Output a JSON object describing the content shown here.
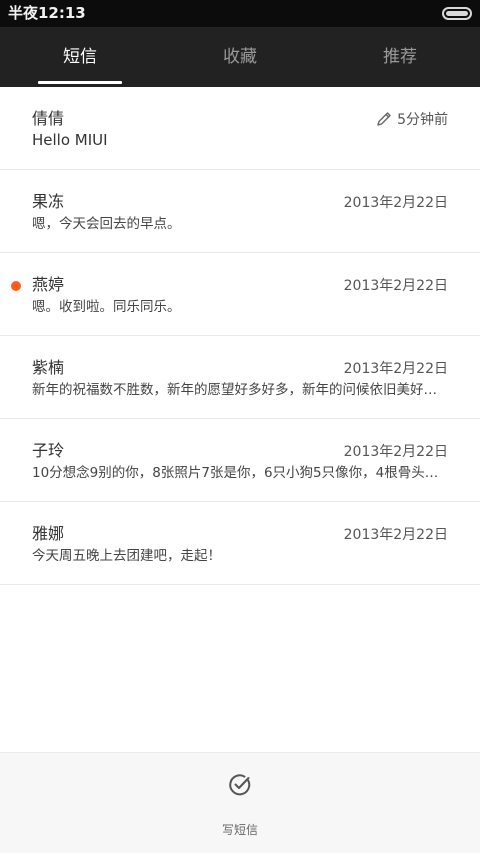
{
  "status_bar": {
    "time": "半夜12:13",
    "battery_icon": "battery-icon"
  },
  "tabs": [
    {
      "label": "短信",
      "active": true
    },
    {
      "label": "收藏",
      "active": false
    },
    {
      "label": "推荐",
      "active": false
    }
  ],
  "conversations": [
    {
      "name": "倩倩",
      "preview": "Hello MIUI",
      "time": "5分钟前",
      "draft": true,
      "unread": false
    },
    {
      "name": "果冻",
      "preview": "嗯，今天会回去的早点。",
      "time": "2013年2月22日",
      "draft": false,
      "unread": false
    },
    {
      "name": "燕婷",
      "preview": "嗯。收到啦。同乐同乐。",
      "time": "2013年2月22日",
      "draft": false,
      "unread": true
    },
    {
      "name": "紫楠",
      "preview": "新年的祝福数不胜数，新年的愿望好多好多，新年的问候依旧美好…",
      "time": "2013年2月22日",
      "draft": false,
      "unread": false
    },
    {
      "name": "子玲",
      "preview": "10分想念9别的你，8张照片7张是你，6只小狗5只像你，4根骨头…",
      "time": "2013年2月22日",
      "draft": false,
      "unread": false
    },
    {
      "name": "雅娜",
      "preview": "今天周五晚上去团建吧，走起！",
      "time": "2013年2月22日",
      "draft": false,
      "unread": false
    }
  ],
  "compose": {
    "label": "写短信",
    "icon": "compose-check-icon"
  },
  "colors": {
    "tab_bar_bg": "#222222",
    "status_bar_bg": "#0c0c0c",
    "unread_dot": "#ff5b1a"
  }
}
